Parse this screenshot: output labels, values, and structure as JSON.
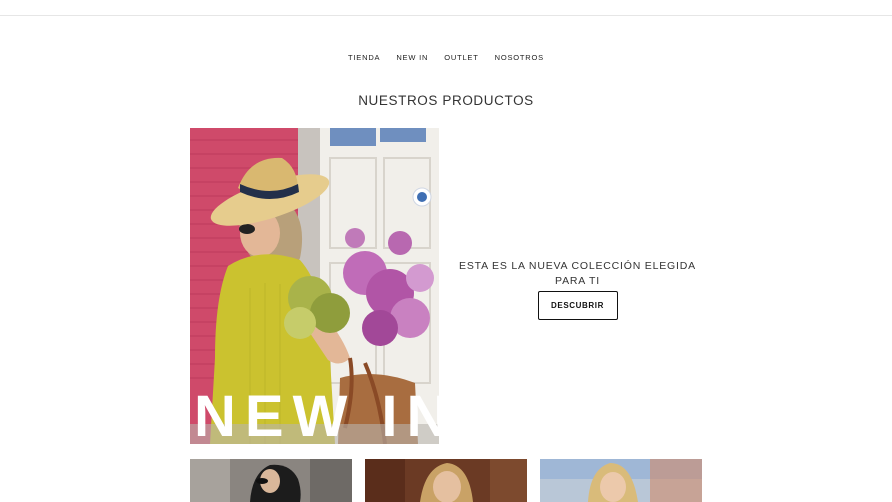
{
  "nav": {
    "items": [
      {
        "label": "TIENDA"
      },
      {
        "label": "NEW IN"
      },
      {
        "label": "OUTLET"
      },
      {
        "label": "NOSOTROS"
      }
    ]
  },
  "section": {
    "title": "NUESTROS PRODUCTOS"
  },
  "hero": {
    "overlay_text": "NEW IN",
    "tagline": "ESTA ES LA NUEVA COLECCIÓN ELEGIDA PARA TI",
    "cta_label": "DESCUBRIR"
  },
  "colors": {
    "accent": "#111111",
    "dress": "#c9c12f",
    "hat": "#e2c88b",
    "wall": "#d6496a",
    "flowers": "#b85fb0"
  }
}
